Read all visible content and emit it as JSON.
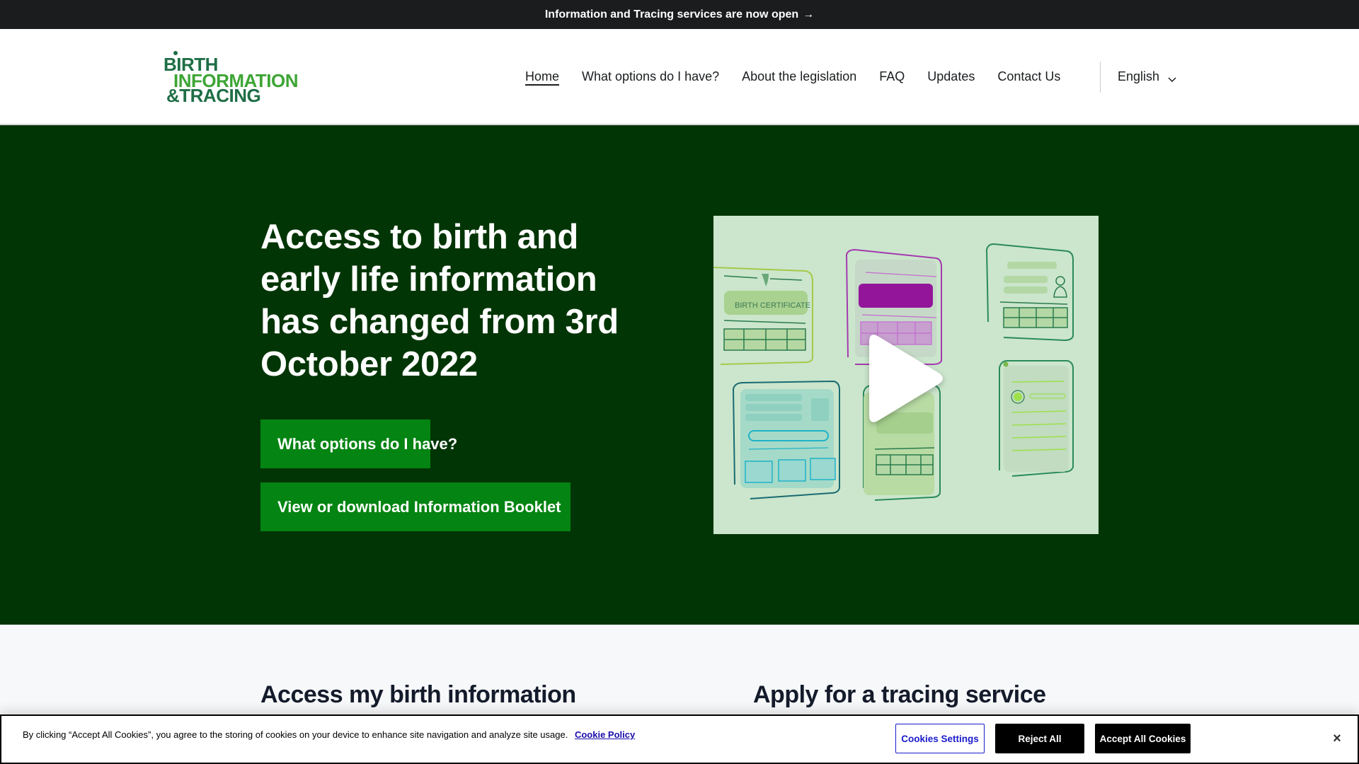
{
  "announcement": {
    "text": "Information and Tracing services are now open",
    "arrow_icon": "→"
  },
  "header": {
    "logo": {
      "line1": "BIRTH",
      "line2": "INFORMATION",
      "line3": "&TRACING"
    },
    "nav": [
      {
        "label": "Home",
        "active": true
      },
      {
        "label": "What options do I have?"
      },
      {
        "label": "About the legislation"
      },
      {
        "label": "FAQ"
      },
      {
        "label": "Updates"
      },
      {
        "label": "Contact Us"
      }
    ],
    "language": {
      "selected": "English",
      "icon": "chevron-down-icon"
    }
  },
  "hero": {
    "title": "Access to birth and early life information has changed from 3rd October 2022",
    "buttons": [
      {
        "label": "What options do I have?"
      },
      {
        "label": "View or download Information Booklet"
      }
    ],
    "video": {
      "thumbnail_text": "BIRTH CERTIFICATE",
      "play_icon": "play-icon"
    }
  },
  "sections": [
    {
      "title": "Access my birth information"
    },
    {
      "title": "Apply for a tracing service"
    }
  ],
  "cookie_banner": {
    "text": "By clicking “Accept All Cookies”, you agree to the storing of cookies on your device to enhance site navigation and analyze site usage.",
    "policy_link": "Cookie Policy",
    "settings_label": "Cookies Settings",
    "reject_label": "Reject All",
    "accept_label": "Accept All Cookies",
    "close_icon": "×"
  },
  "colors": {
    "announcement_bg": "#1b1c1e",
    "hero_bg": "#023505",
    "button_green": "#048412",
    "logo_dark": "#1f6e46",
    "logo_light": "#3ea535",
    "video_bg": "#cbe6cc",
    "link_blue": "#1a0dab"
  }
}
